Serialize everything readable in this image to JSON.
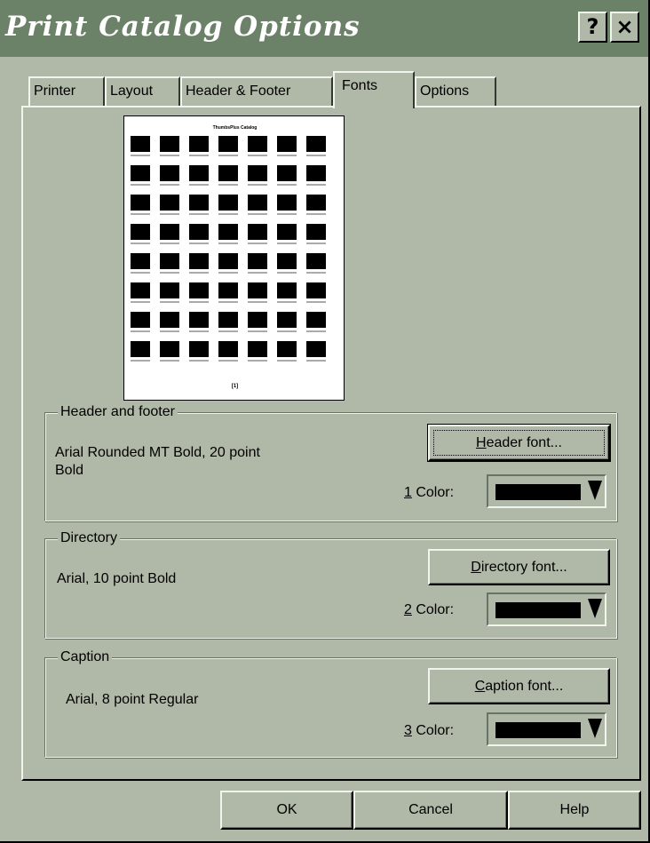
{
  "window": {
    "title": "Print Catalog Options",
    "help_label": "?",
    "close_label": "×"
  },
  "tabs": [
    {
      "label": "Printer",
      "active": false
    },
    {
      "label": "Layout",
      "active": false
    },
    {
      "label": "Header & Footer",
      "active": false
    },
    {
      "label": "Fonts",
      "active": true
    },
    {
      "label": "Options",
      "active": false
    }
  ],
  "preview": {
    "page_title": "ThumbsPlus Catalog",
    "page_number": "[1]",
    "rows": 8,
    "columns": 7
  },
  "groups": {
    "header_footer": {
      "label": "Header and footer",
      "font_description": "Arial Rounded MT Bold, 20 point\nBold",
      "button_label_mnemonic": "H",
      "button_label_rest": "eader font...",
      "color_mnemonic": "1",
      "color_label_rest": " Color:",
      "color_value": "#000000"
    },
    "directory": {
      "label": "Directory",
      "font_description": "Arial, 10 point Bold",
      "button_label_mnemonic": "D",
      "button_label_rest": "irectory font...",
      "color_mnemonic": "2",
      "color_label_rest": " Color:",
      "color_value": "#000000"
    },
    "caption": {
      "label": "Caption",
      "font_description": "Arial, 8 point Regular",
      "button_label_mnemonic": "C",
      "button_label_rest": "aption font...",
      "color_mnemonic": "3",
      "color_label_rest": " Color:",
      "color_value": "#000000"
    }
  },
  "buttons": {
    "ok": "OK",
    "cancel": "Cancel",
    "help": "Help"
  },
  "colors": {
    "dialog_face": "#b0b8a8",
    "title_bar": "#6b8268",
    "title_text": "#ffffff"
  }
}
